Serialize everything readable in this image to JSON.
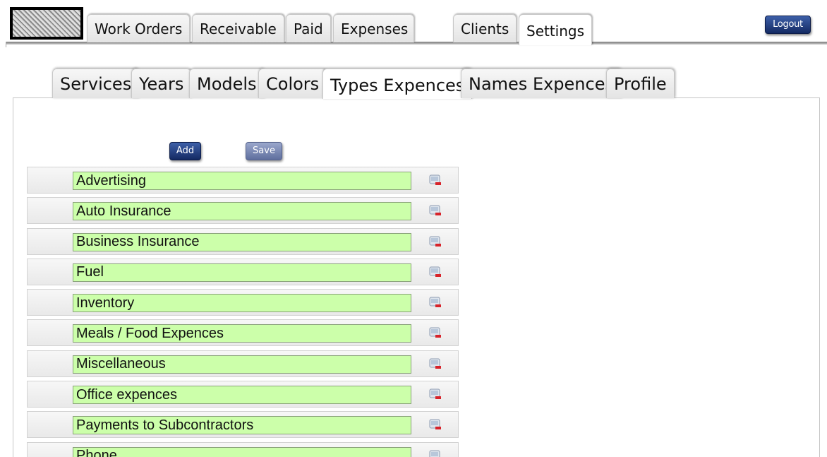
{
  "main_tabs": [
    {
      "label": "Work Orders"
    },
    {
      "label": "Receivable"
    },
    {
      "label": "Paid"
    },
    {
      "label": "Expenses"
    },
    {
      "label": "Clients"
    },
    {
      "label": "Settings"
    }
  ],
  "logout_label": "Logout",
  "sub_tabs": [
    {
      "label": "Services"
    },
    {
      "label": "Years"
    },
    {
      "label": "Models"
    },
    {
      "label": "Colors"
    },
    {
      "label": "Types Expences"
    },
    {
      "label": "Names Expences"
    },
    {
      "label": "Profile"
    }
  ],
  "toolbar": {
    "add_label": "Add",
    "save_label": "Save"
  },
  "expense_types": [
    {
      "value": "Advertising"
    },
    {
      "value": "Auto Insurance"
    },
    {
      "value": "Business Insurance"
    },
    {
      "value": "Fuel"
    },
    {
      "value": "Inventory"
    },
    {
      "value": "Meals / Food Expences"
    },
    {
      "value": "Miscellaneous"
    },
    {
      "value": "Office expences"
    },
    {
      "value": "Payments to Subcontractors"
    },
    {
      "value": "Phone"
    }
  ],
  "colors": {
    "button_blue": "#1f3a80",
    "input_green": "#ccffaa"
  },
  "icons": {
    "delete": "delete-row-icon"
  }
}
